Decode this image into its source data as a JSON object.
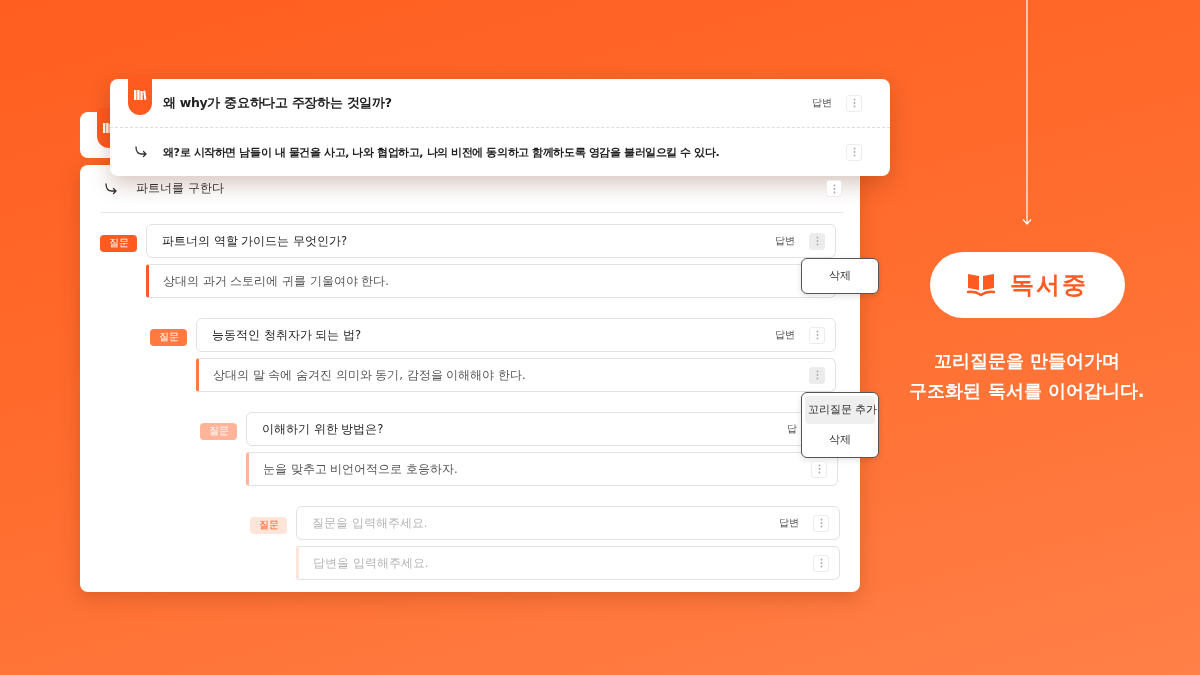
{
  "header_card": {
    "question": {
      "text": "왜 why가 중요하다고 주장하는 것일까?",
      "action": "답변"
    },
    "answer": {
      "text": "왜?로 시작하면 남들이 내 물건을 사고, 나와 협업하고, 나의 비전에 동의하고 함께하도록 영감을 불러일으킬 수 있다."
    }
  },
  "panel": {
    "title": "파트너를 구한다",
    "nodes": [
      {
        "kind": "entry",
        "color": "#ff5a1f",
        "badge": "질문",
        "question": {
          "text": "파트너의 역할 가이드는 무엇인가?",
          "action": "답변",
          "menu": [
            {
              "label": "삭제",
              "selected": false
            }
          ]
        },
        "answer": {
          "text": "상대의 과거 스토리에 귀를 기울여야 한다.",
          "more_button": false
        },
        "children": [
          {
            "kind": "entry",
            "color": "#ff7a40",
            "badge": "질문",
            "question": {
              "text": "능동적인 청취자가 되는 법?",
              "action": "답변"
            },
            "answer": {
              "text": "상대의 말 속에 숨겨진 의미와 동기, 감정을 이해해야 한다.",
              "menu": [
                {
                  "label": "꼬리질문 추가",
                  "selected": true
                },
                {
                  "label": "삭제",
                  "selected": false
                }
              ]
            },
            "children": [
              {
                "kind": "entry",
                "color": "#ffb398",
                "badge": "질문",
                "question": {
                  "text": "이해하기 위한 방법은?",
                  "action": "답",
                  "more_button": false
                },
                "answer": {
                  "text": "눈을 맞추고 비언어적으로 호응하자."
                },
                "children": [
                  {
                    "kind": "draft",
                    "color": "#ffe4d9",
                    "badge": "질문",
                    "question": {
                      "placeholder": "질문을 입력해주세요.",
                      "action": "답변"
                    },
                    "answer": {
                      "placeholder": "답변을 입력해주세요."
                    }
                  }
                ]
              }
            ]
          }
        ]
      }
    ]
  },
  "status_pill": {
    "label": "독서중"
  },
  "caption": "꼬리질문을 만들어가며\n구조화된 독서를 이어갑니다."
}
